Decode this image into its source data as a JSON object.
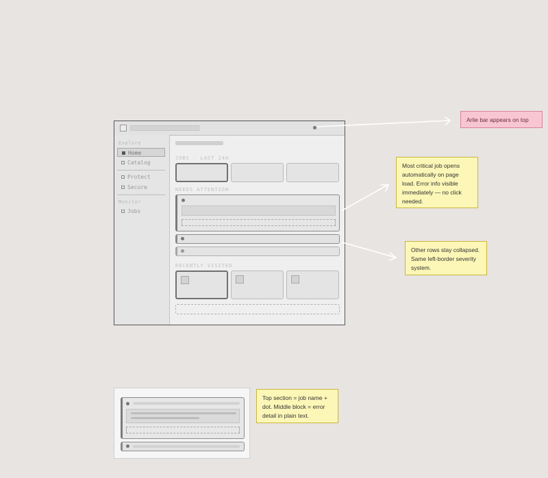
{
  "sidebar": {
    "section_explore": "Explore",
    "section_monitor": "Monitor",
    "items": [
      {
        "label": "Home"
      },
      {
        "label": "Catalog"
      },
      {
        "label": "Protect"
      },
      {
        "label": "Secure"
      },
      {
        "label": "Jobs"
      }
    ]
  },
  "main": {
    "jobs_label": "JOBS · LAST 24H",
    "needs_attention_label": "NEEDS ATTENTION",
    "recently_visited_label": "RECENTLY VISITED"
  },
  "notes": {
    "arlie": "Arlie bar appears on top",
    "critical": "Most critical job opens automatically on page load. Error info visible immediately — no click needed.",
    "collapsed": "Other rows stay collapsed. Same left-border severity system.",
    "detail": "Top section = job name + dot. Middle block = error detail in plain text."
  },
  "colors": {
    "note_yellow": "#fcf7b7",
    "note_pink": "#f8c6d3",
    "background": "#e8e4e2"
  }
}
